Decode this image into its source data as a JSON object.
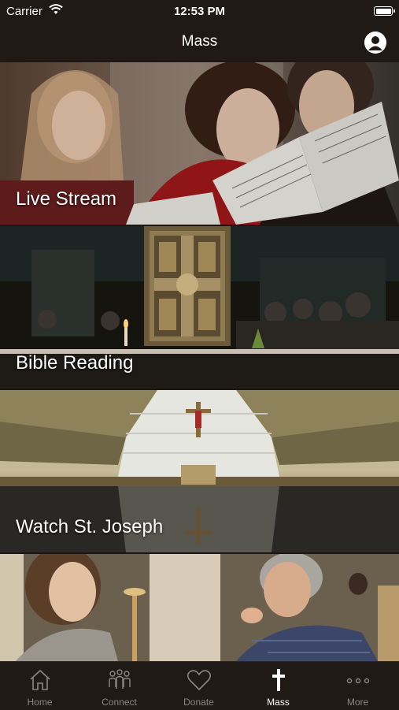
{
  "status_bar": {
    "carrier": "Carrier",
    "time": "12:53 PM"
  },
  "nav": {
    "title": "Mass",
    "profile_icon": "profile-icon"
  },
  "tiles": [
    {
      "label": "Live Stream",
      "image": "choir-singers-photo"
    },
    {
      "label": "Bible Reading",
      "image": "ornate-bible-on-altar-photo"
    },
    {
      "label": "Watch St. Joseph",
      "image": "church-sanctuary-photo"
    },
    {
      "label": "",
      "image": "communion-line-photo"
    }
  ],
  "tab_bar": {
    "items": [
      {
        "label": "Home",
        "icon": "home-icon",
        "active": false
      },
      {
        "label": "Connect",
        "icon": "people-icon",
        "active": false
      },
      {
        "label": "Donate",
        "icon": "heart-icon",
        "active": false
      },
      {
        "label": "Mass",
        "icon": "cross-icon",
        "active": true
      },
      {
        "label": "More",
        "icon": "more-dots-icon",
        "active": false
      }
    ]
  },
  "colors": {
    "bar_background": "#1f1a16",
    "tab_inactive": "#8c8783",
    "tab_active": "#ffffff"
  }
}
